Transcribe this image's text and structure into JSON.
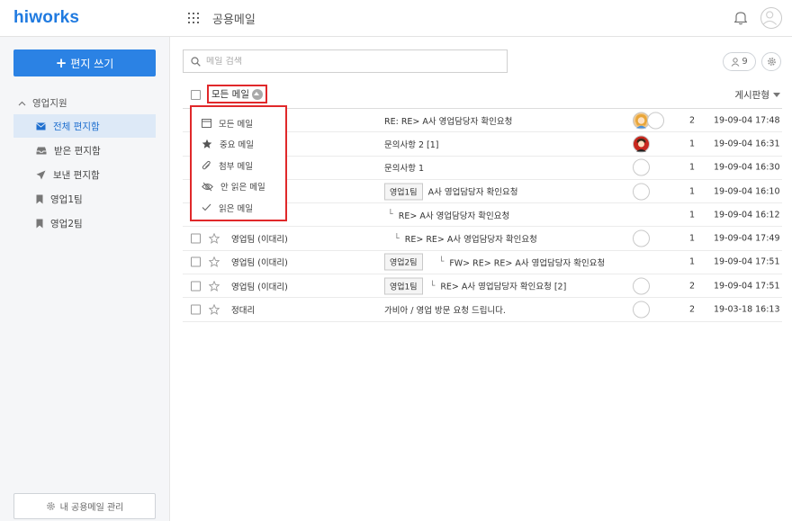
{
  "header": {
    "logo": "hiworks",
    "app_title": "공용메일"
  },
  "sidebar": {
    "compose_label": "편지 쓰기",
    "section_label": "영업지원",
    "items": [
      {
        "label": "전체 편지함",
        "icon": "envelope-icon",
        "active": true
      },
      {
        "label": "받은 편지함",
        "icon": "inbox-icon",
        "active": false
      },
      {
        "label": "보낸 편지함",
        "icon": "paper-plane-icon",
        "active": false
      },
      {
        "label": "영업1팀",
        "icon": "bookmark-icon",
        "active": false
      },
      {
        "label": "영업2팀",
        "icon": "bookmark-icon",
        "active": false
      }
    ],
    "manage_label": "내 공용메일 관리"
  },
  "search": {
    "placeholder": "메일 검색"
  },
  "toolbar": {
    "member_count": "9",
    "filter_label": "모든 메일",
    "view_mode_label": "게시판형"
  },
  "filter_menu": {
    "items": [
      {
        "label": "모든 메일",
        "icon": "calendar-icon"
      },
      {
        "label": "중요 메일",
        "icon": "star-filled-icon"
      },
      {
        "label": "첨부 메일",
        "icon": "paperclip-icon"
      },
      {
        "label": "안 읽은 메일",
        "icon": "eye-slash-icon"
      },
      {
        "label": "읽은 메일",
        "icon": "check-icon"
      }
    ]
  },
  "mails": [
    {
      "sender": "",
      "tag": "",
      "reply_prefix": "",
      "subject": "RE: RE> A사 영업담당자 확인요청",
      "count": "2",
      "date": "19-09-04 17:48"
    },
    {
      "sender": "",
      "tag": "",
      "reply_prefix": "",
      "subject": "문의사항 2 [1]",
      "count": "1",
      "date": "19-09-04 16:31"
    },
    {
      "sender": "",
      "tag": "",
      "reply_prefix": "",
      "subject": "문의사항 1",
      "count": "1",
      "date": "19-09-04 16:30"
    },
    {
      "sender": "",
      "tag": "영업1팀",
      "reply_prefix": "",
      "subject": "A사 영업담당자 확인요청",
      "count": "1",
      "date": "19-09-04 16:10"
    },
    {
      "sender": "",
      "tag": "",
      "reply_prefix": "└",
      "subject": "RE> A사 영업담당자 확인요청",
      "count": "1",
      "date": "19-09-04 16:12"
    },
    {
      "sender": "영업팀 (이대리)",
      "tag": "",
      "reply_prefix": "└",
      "subject": "RE> RE> A사 영업담당자 확인요청",
      "count": "1",
      "date": "19-09-04 17:49"
    },
    {
      "sender": "영업팀 (이대리)",
      "tag": "영업2팀",
      "reply_prefix": "└",
      "subject": "FW> RE> RE> A사 영업담당자 확인요청",
      "count": "1",
      "date": "19-09-04 17:51"
    },
    {
      "sender": "영업팀 (이대리)",
      "tag": "영업1팀",
      "reply_prefix": "└",
      "subject": "RE> A사 영업담당자 확인요청 [2]",
      "count": "2",
      "date": "19-09-04 17:51"
    },
    {
      "sender": "정대리",
      "tag": "",
      "reply_prefix": "",
      "subject": "가비아 / 영업 방문 요청 드립니다.",
      "count": "2",
      "date": "19-03-18 16:13"
    }
  ],
  "colors": {
    "brand": "#1f7ae0",
    "compose_button": "#2b82e4",
    "active_item_bg": "#dde9f7",
    "highlight_border": "#e0282a"
  }
}
